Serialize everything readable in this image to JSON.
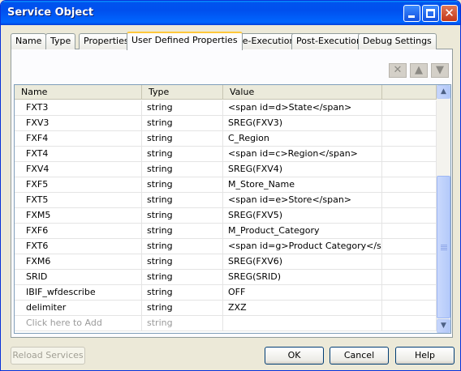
{
  "window": {
    "title": "Service Object"
  },
  "tabs": [
    {
      "label": "Name"
    },
    {
      "label": "Type"
    },
    {
      "label": "Properties"
    },
    {
      "label": "User Defined Properties"
    },
    {
      "label": "Pre-Execution"
    },
    {
      "label": "Post-Execution"
    },
    {
      "label": "Debug Settings"
    }
  ],
  "active_tab": "User Defined Properties",
  "toolbar": {
    "delete_icon": "delete-x-icon",
    "up_icon": "arrow-up-icon",
    "down_icon": "arrow-down-icon"
  },
  "grid": {
    "columns": [
      "Name",
      "Type",
      "Value"
    ],
    "rows": [
      {
        "name": "FXT3",
        "type": "string",
        "value": "<span id=d>State</span>"
      },
      {
        "name": "FXV3",
        "type": "string",
        "value": "SREG(FXV3)"
      },
      {
        "name": "FXF4",
        "type": "string",
        "value": "C_Region"
      },
      {
        "name": "FXT4",
        "type": "string",
        "value": "<span id=c>Region</span>"
      },
      {
        "name": "FXV4",
        "type": "string",
        "value": "SREG(FXV4)"
      },
      {
        "name": "FXF5",
        "type": "string",
        "value": "M_Store_Name"
      },
      {
        "name": "FXT5",
        "type": "string",
        "value": "<span id=e>Store</span>"
      },
      {
        "name": "FXM5",
        "type": "string",
        "value": "SREG(FXV5)"
      },
      {
        "name": "FXF6",
        "type": "string",
        "value": "M_Product_Category"
      },
      {
        "name": "FXT6",
        "type": "string",
        "value": "<span id=g>Product Category</span>"
      },
      {
        "name": "FXM6",
        "type": "string",
        "value": "SREG(FXV6)"
      },
      {
        "name": "SRID",
        "type": "string",
        "value": "SREG(SRID)"
      },
      {
        "name": "IBIF_wfdescribe",
        "type": "string",
        "value": "OFF"
      },
      {
        "name": "delimiter",
        "type": "string",
        "value": "ZXZ"
      }
    ],
    "add_row": {
      "name": "Click here to Add",
      "type": "string",
      "value": ""
    }
  },
  "buttons": {
    "reload": "Reload Services",
    "ok": "OK",
    "cancel": "Cancel",
    "help": "Help"
  }
}
